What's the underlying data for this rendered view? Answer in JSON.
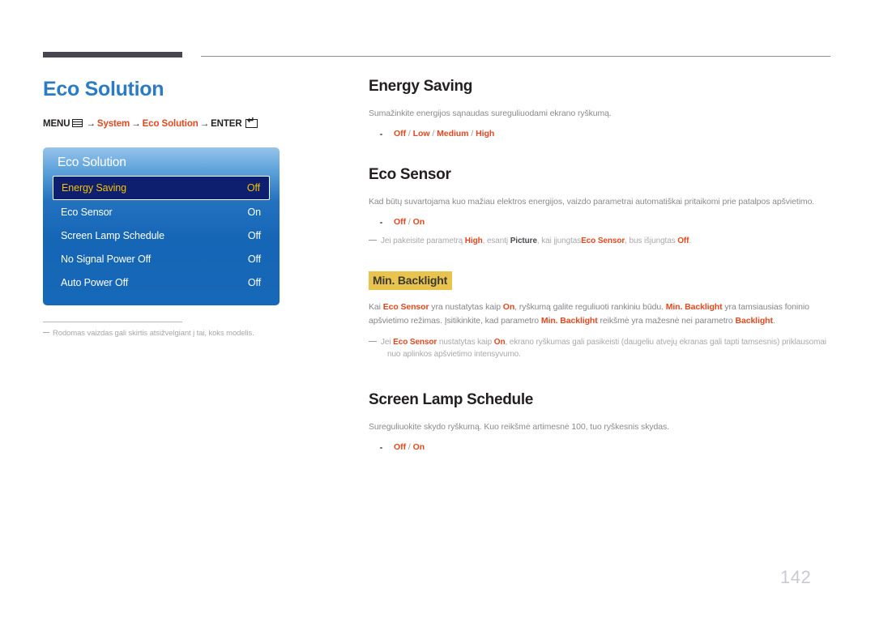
{
  "page": {
    "number": "142"
  },
  "left": {
    "title": "Eco Solution",
    "breadcrumb": {
      "menu_label": "MENU",
      "menu_icon": "menu-bars-icon",
      "arrow1": "→",
      "item1": "System",
      "arrow2": "→",
      "item2": "Eco Solution",
      "arrow3": "→",
      "enter_label": "ENTER",
      "enter_icon": "enter-key-icon"
    },
    "osd": {
      "title": "Eco Solution",
      "rows": [
        {
          "label": "Energy Saving",
          "value": "Off",
          "selected": true
        },
        {
          "label": "Eco Sensor",
          "value": "On",
          "selected": false
        },
        {
          "label": "Screen Lamp Schedule",
          "value": "Off",
          "selected": false
        },
        {
          "label": "No Signal Power Off",
          "value": "Off",
          "selected": false
        },
        {
          "label": "Auto Power Off",
          "value": "Off",
          "selected": false
        }
      ]
    },
    "note": "Rodomas vaizdas gali skirtis atsižvelgiant į tai, koks modelis."
  },
  "right": {
    "energy_saving": {
      "heading": "Energy Saving",
      "description": "Sumažinkite energijos sąnaudas sureguliuodami ekrano ryškumą.",
      "options": [
        "Off",
        "Low",
        "Medium",
        "High"
      ]
    },
    "eco_sensor": {
      "heading": "Eco Sensor",
      "description": "Kad būtų suvartojama kuo mažiau elektros energijos, vaizdo parametrai automatiškai pritaikomi prie patalpos apšvietimo.",
      "options": [
        "Off",
        "On"
      ],
      "note_parts": {
        "p1": "Jei pakeisite parametrą ",
        "t1": "High",
        "p2": ", esantį ",
        "t2": "Picture",
        "p3": ", kai įjungtas",
        "t3": "Eco Sensor",
        "p4": ", bus išjungtas ",
        "t4": "Off",
        "p5": "."
      }
    },
    "min_backlight": {
      "heading": "Min. Backlight",
      "para_parts": {
        "p1": "Kai ",
        "t1": "Eco Sensor",
        "p2": " yra nustatytas kaip ",
        "t2": "On",
        "p3": ", ryškumą galite reguliuoti rankiniu būdu. ",
        "t3": "Min. Backlight",
        "p4": " yra tamsiausias foninio apšvietimo režimas. Įsitikinkite, kad parametro ",
        "t4": "Min. Backlight",
        "p5": " reikšmė yra mažesnė nei parametro ",
        "t5": "Backlight",
        "p6": "."
      },
      "note_parts": {
        "p1": "Jei ",
        "t1": "Eco Sensor",
        "p2": " nustatytas kaip ",
        "t2": "On",
        "p3": ", ekrano ryškumas gali pasikeisti (daugeliu atvejų ekranas gali tapti tamsesnis) priklausomai",
        "p4": "nuo aplinkos apšvietimo intensyvumo."
      }
    },
    "screen_lamp_schedule": {
      "heading": "Screen Lamp Schedule",
      "description": "Sureguliuokite skydo ryškumą. Kuo reikšmė artimesnė 100, tuo ryškesnis skydas.",
      "options": [
        "Off",
        "On"
      ]
    }
  }
}
